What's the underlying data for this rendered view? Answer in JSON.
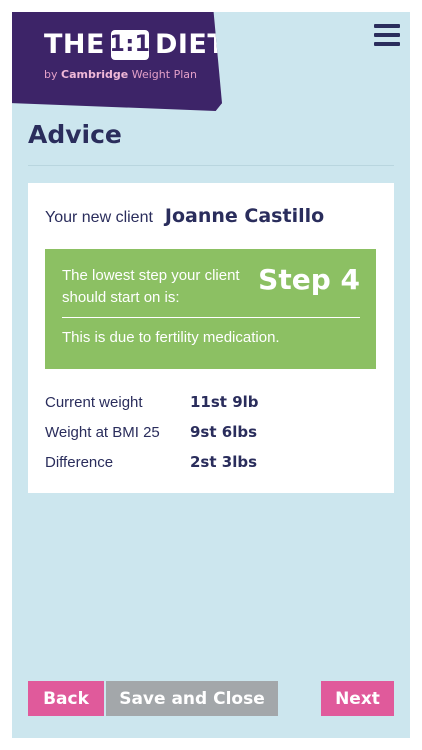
{
  "brand": {
    "title_pre": "THE",
    "title_mark": "1:1",
    "title_post": "DIET",
    "subtitle_by": "by ",
    "subtitle_brand": "Cambridge",
    "subtitle_rest": " Weight Plan",
    "color": "#3d2468"
  },
  "header": {
    "menu_icon": "hamburger-menu-icon"
  },
  "page": {
    "title": "Advice"
  },
  "client": {
    "label": "Your new client",
    "name": "Joanne Castillo"
  },
  "step": {
    "text": "The lowest step your client should start on is:",
    "value": "Step 4",
    "reason": "This is due to fertility medication.",
    "color": "#8cc063"
  },
  "stats": [
    {
      "label": "Current weight",
      "value": "11st 9lb"
    },
    {
      "label": "Weight at BMI 25",
      "value": "9st 6lbs"
    },
    {
      "label": "Difference",
      "value": "2st 3lbs"
    }
  ],
  "buttons": {
    "back": "Back",
    "save": "Save and Close",
    "next": "Next",
    "accent": "#e05a9b",
    "neutral": "#a3a7aa"
  }
}
